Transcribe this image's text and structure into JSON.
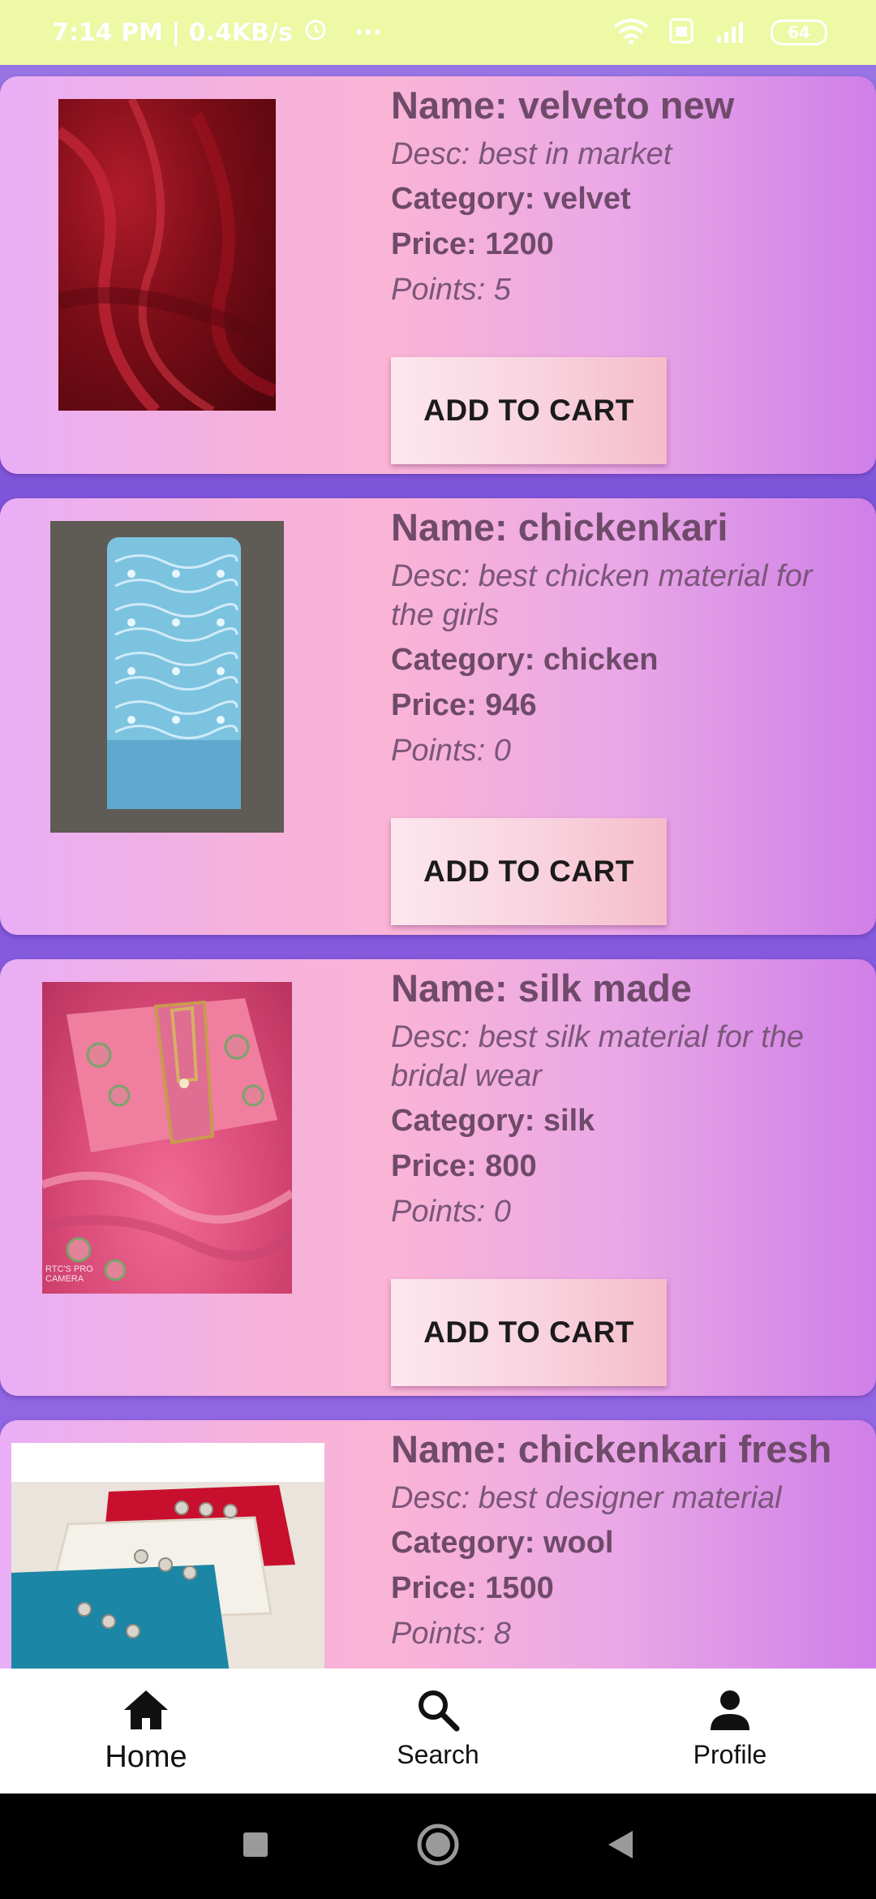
{
  "status_bar": {
    "time_info": "7:14 PM | 0.4KB/s",
    "more": "···",
    "battery": "64"
  },
  "products": [
    {
      "name": "Name: velveto new",
      "desc": "Desc: best in market",
      "category": "Category: velvet",
      "price": "Price: 1200",
      "points": "Points: 5",
      "button": "ADD TO CART",
      "image_icon": "red-velvet-fabric-image"
    },
    {
      "name": "Name: chickenkari",
      "desc": "Desc: best chicken material for the girls",
      "category": "Category: chicken",
      "price": "Price: 946",
      "points": "Points: 0",
      "button": "ADD TO CART",
      "image_icon": "blue-chikankari-fabric-image"
    },
    {
      "name": "Name: silk made",
      "desc": "Desc: best silk material for the bridal wear",
      "category": "Category: silk",
      "price": "Price: 800",
      "points": "Points: 0",
      "button": "ADD TO CART",
      "image_icon": "pink-silk-suit-image",
      "image_watermark": "RTC'S PRO CAMERA"
    },
    {
      "name": "Name: chickenkari fresh",
      "desc": "Desc: best designer material",
      "category": "Category: wool",
      "price": "Price: 1500",
      "points": "Points: 8",
      "image_icon": "folded-fabrics-image"
    }
  ],
  "bottom_nav": {
    "items": [
      {
        "label": "Home",
        "icon": "home-icon",
        "active": true
      },
      {
        "label": "Search",
        "icon": "search-icon",
        "active": false
      },
      {
        "label": "Profile",
        "icon": "person-icon",
        "active": false
      }
    ]
  },
  "colors": {
    "status_bar": "#eef9a6",
    "card_gradient_start": "#e9aef5",
    "card_gradient_end": "#cf7fe8",
    "text_primary": "#6f4a6a",
    "page_background": "#7a4fd8"
  }
}
